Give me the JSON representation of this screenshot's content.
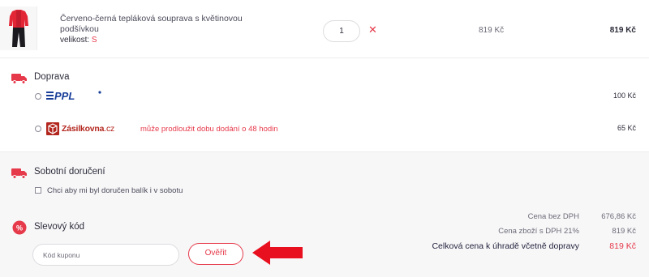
{
  "product": {
    "name": "Červeno-černá tepláková souprava s květinovou podšívkou",
    "size_label": "velikost:",
    "size_value": "S",
    "quantity": "1",
    "remove_icon": "close-icon",
    "unit_price": "819 Kč",
    "total_price": "819 Kč"
  },
  "shipping": {
    "title": "Doprava",
    "icon": "truck-icon",
    "options": [
      {
        "carrier": "PPL",
        "logo_text": "PPL",
        "note": "",
        "price": "100 Kč",
        "selected": false
      },
      {
        "carrier": "Zásilkovna",
        "logo_text": "Zásilkovna",
        "logo_suffix": ".cz",
        "note": "může prodloužit dobu dodání o 48 hodin",
        "price": "65 Kč",
        "selected": false
      }
    ]
  },
  "saturday": {
    "title": "Sobotní doručení",
    "icon": "truck-icon",
    "checkbox_label": "Chci aby mi byl doručen balík i v sobotu",
    "checked": false
  },
  "coupon": {
    "title": "Slevový kód",
    "icon": "percent-icon",
    "input_placeholder": "Kód kuponu",
    "input_value": "",
    "verify_label": "Ověřit"
  },
  "summary": {
    "net_label": "Cena bez DPH",
    "net_value": "676,86 Kč",
    "vat_label": "Cena zboží s DPH 21%",
    "vat_value": "819 Kč",
    "grand_label": "Celková cena k úhradě včetně dopravy",
    "grand_value": "819 Kč"
  },
  "colors": {
    "accent": "#e6394a",
    "arrow": "#e8101e",
    "ppl_blue": "#1a3f99",
    "zasilkovna_red": "#b3261e"
  }
}
